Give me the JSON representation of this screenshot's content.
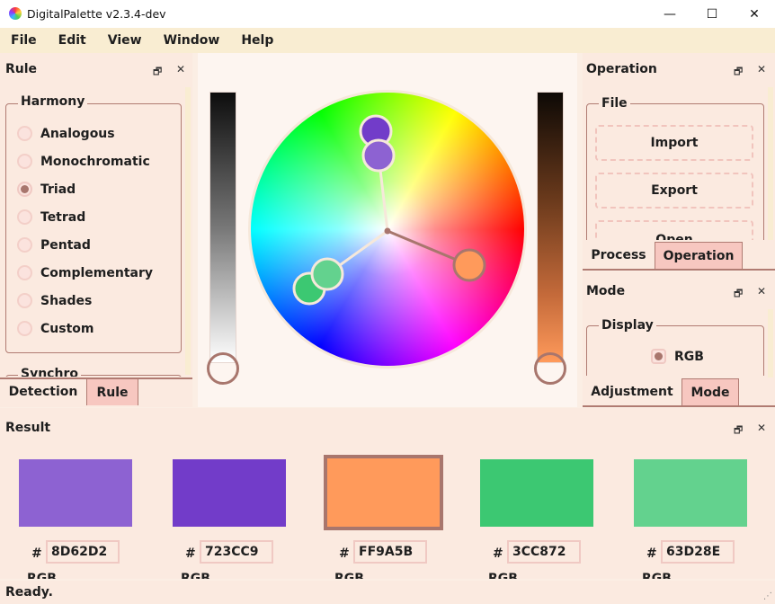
{
  "window": {
    "title": "DigitalPalette v2.3.4-dev",
    "min": "—",
    "max": "☐",
    "close": "✕"
  },
  "menu": [
    "File",
    "Edit",
    "View",
    "Window",
    "Help"
  ],
  "rule_panel": {
    "title": "Rule",
    "float": "🗗",
    "close": "✕",
    "harmony_title": "Harmony",
    "options": [
      "Analogous",
      "Monochromatic",
      "Triad",
      "Tetrad",
      "Pentad",
      "Complementary",
      "Shades",
      "Custom"
    ],
    "selected": "Triad",
    "synchro_title": "Synchro",
    "tabs": [
      "Detection",
      "Rule"
    ],
    "active_tab": "Rule"
  },
  "operation_panel": {
    "title": "Operation",
    "float": "🗗",
    "close": "✕",
    "file_title": "File",
    "buttons": [
      "Import",
      "Export",
      "Open"
    ],
    "tabs": [
      "Process",
      "Operation"
    ],
    "active_tab": "Operation"
  },
  "mode_panel": {
    "title": "Mode",
    "float": "🗗",
    "close": "✕",
    "display_title": "Display",
    "option": "RGB",
    "tabs": [
      "Adjustment",
      "Mode"
    ],
    "active_tab": "Mode"
  },
  "result_panel": {
    "title": "Result",
    "float": "🗗",
    "close": "✕",
    "hash": "#",
    "rgb_label": "RGB",
    "swatches": [
      {
        "hex": "8D62D2",
        "color": "#8D62D2"
      },
      {
        "hex": "723CC9",
        "color": "#723CC9"
      },
      {
        "hex": "FF9A5B",
        "color": "#FF9A5B"
      },
      {
        "hex": "3CC872",
        "color": "#3CC872"
      },
      {
        "hex": "63D28E",
        "color": "#63D28E"
      }
    ],
    "selected_index": 2
  },
  "status": {
    "text": "Ready."
  },
  "colors": {
    "accent": "#A8766D",
    "tab_active": "#F7C7C0",
    "panel_bg": "#FBEAE0",
    "menu_bg": "#F9EDD2"
  }
}
